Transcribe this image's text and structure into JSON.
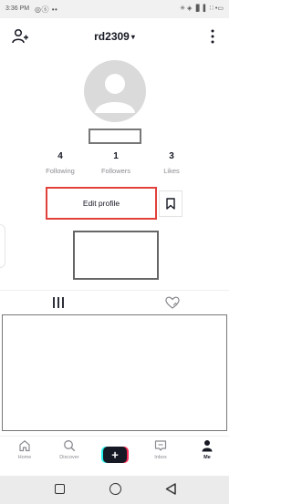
{
  "status_bar": {
    "time": "3:36 PM",
    "left_icons": "◎ⓢ ••",
    "right_icons": "✳ ◈ ▐▎▌ ∷ •▭"
  },
  "header": {
    "username": "rd2309",
    "caret": "▾",
    "add_friend_icon": "add-friend-icon",
    "more_icon": "more-vertical-icon"
  },
  "profile": {
    "stats": [
      {
        "value": "4",
        "label": "Following"
      },
      {
        "value": "1",
        "label": "Followers"
      },
      {
        "value": "3",
        "label": "Likes"
      }
    ],
    "edit_profile_label": "Edit profile",
    "edit_profile_highlight_color": "#e2413b",
    "bookmark_icon": "bookmark-icon"
  },
  "tabs": {
    "videos_icon": "grid-bars-icon",
    "liked_icon": "liked-heart-icon"
  },
  "bottom_nav": {
    "items": [
      {
        "label": "Home",
        "icon": "home-icon"
      },
      {
        "label": "Discover",
        "icon": "search-icon"
      },
      {
        "label": "Inbox",
        "icon": "inbox-icon"
      },
      {
        "label": "Me",
        "icon": "profile-icon"
      }
    ],
    "create_symbol": "+",
    "create_colors": {
      "left": "#25f4ee",
      "right": "#fe2c55",
      "center": "#161823"
    }
  },
  "android_nav": {
    "buttons": [
      "recent-apps",
      "home",
      "back"
    ]
  }
}
